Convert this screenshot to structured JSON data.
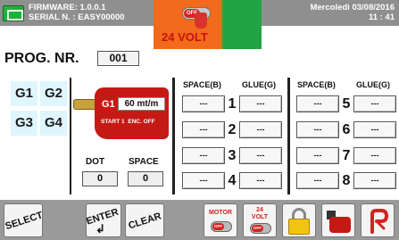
{
  "header": {
    "firmware_label": "FIRMWARE:",
    "firmware_value": "1.0.0.1",
    "serial_label": "SERIAL N. :",
    "serial_value": "EASY00000",
    "day": "Mercoledì",
    "date": "03/08/2016",
    "time": "11 : 41",
    "volt_toggle_state": "OFF",
    "volt_label": "24 VOLT",
    "accent_orange": "#f26a1b",
    "accent_green": "#21a443",
    "bar_grey": "#8f8f8f"
  },
  "program": {
    "label": "PROG. NR.",
    "number": "001"
  },
  "groups": [
    "G1",
    "G2",
    "G3",
    "G4"
  ],
  "gun": {
    "name": "G1",
    "speed": "60 mt/m",
    "start": "START 1",
    "encoder": "ENC. OFF",
    "dot_label": "DOT",
    "space_label": "SPACE",
    "dot_value": "0",
    "space_value": "0"
  },
  "table": {
    "headers": [
      "SPACE(B)",
      "GLUE(G)",
      "SPACE(B)",
      "GLUE(G)"
    ],
    "rows": [
      {
        "num": "1",
        "space": "---",
        "glue": "---"
      },
      {
        "num": "2",
        "space": "---",
        "glue": "---"
      },
      {
        "num": "3",
        "space": "---",
        "glue": "---"
      },
      {
        "num": "4",
        "space": "---",
        "glue": "---"
      },
      {
        "num": "5",
        "space": "---",
        "glue": "---"
      },
      {
        "num": "6",
        "space": "---",
        "glue": "---"
      },
      {
        "num": "7",
        "space": "---",
        "glue": "---"
      },
      {
        "num": "8",
        "space": "---",
        "glue": "---"
      }
    ]
  },
  "toolbar": {
    "select": "SELECT",
    "enter": "ENTER",
    "enter_arrow": "↲",
    "clear": "CLEAR",
    "motor_label": "MOTOR",
    "motor_state": "OFF",
    "volt_label_line1": "24",
    "volt_label_line2": "VOLT",
    "volt_state": "OFF",
    "icons": [
      "lock-icon",
      "glue-pump-icon",
      "brand-logo-icon"
    ]
  }
}
